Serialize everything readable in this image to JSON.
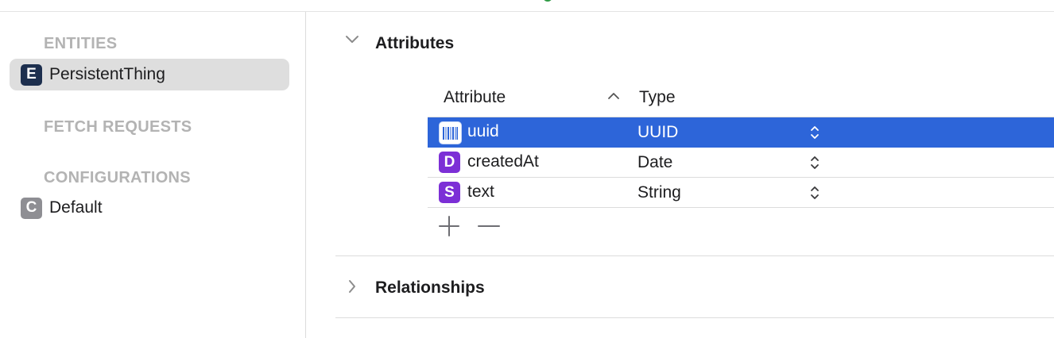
{
  "sidebar": {
    "entities_header": "ENTITIES",
    "entities": [
      {
        "badge": "E",
        "label": "PersistentThing",
        "badge_color": "#1d2f4e",
        "selected": true
      }
    ],
    "fetch_requests_header": "FETCH REQUESTS",
    "configurations_header": "CONFIGURATIONS",
    "configurations": [
      {
        "badge": "C",
        "label": "Default",
        "badge_color": "#8e8e93"
      }
    ]
  },
  "attributes": {
    "title": "Attributes",
    "columns": {
      "attribute": "Attribute",
      "type": "Type"
    },
    "rows": [
      {
        "icon": "barcode-icon",
        "name": "uuid",
        "type": "UUID",
        "selected": true
      },
      {
        "icon_letter": "D",
        "name": "createdAt",
        "type": "Date",
        "icon_color": "#7c2fd6"
      },
      {
        "icon_letter": "S",
        "name": "text",
        "type": "String",
        "icon_color": "#7c2fd6"
      }
    ]
  },
  "relationships": {
    "title": "Relationships"
  },
  "colors": {
    "selection": "#2d65d9",
    "status_dot": "#2f9a45"
  }
}
